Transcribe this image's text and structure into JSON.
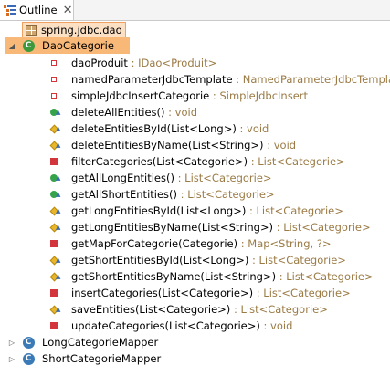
{
  "tab": {
    "title": "Outline",
    "close": "✕"
  },
  "tree": {
    "package": "spring.jdbc.dao",
    "dao_class": "DaoCategorie",
    "members": [
      {
        "name": "daoProduit",
        "type": " : IDao<Produit>",
        "icon": "field-private-icon"
      },
      {
        "name": "namedParameterJdbcTemplate",
        "type": " : NamedParameterJdbcTemplate",
        "icon": "field-private-icon"
      },
      {
        "name": "simpleJdbcInsertCategorie",
        "type": " : SimpleJdbcInsert",
        "icon": "field-private-icon"
      },
      {
        "name": "deleteAllEntities()",
        "type": " : void",
        "icon": "method-public-icon"
      },
      {
        "name": "deleteEntitiesById(List<Long>)",
        "type": " : void",
        "icon": "method-protected-icon"
      },
      {
        "name": "deleteEntitiesByName(List<String>)",
        "type": " : void",
        "icon": "method-protected-icon"
      },
      {
        "name": "filterCategories(List<Categorie>)",
        "type": " : List<Categorie>",
        "icon": "method-private-icon"
      },
      {
        "name": "getAllLongEntities()",
        "type": " : List<Categorie>",
        "icon": "method-public-icon"
      },
      {
        "name": "getAllShortEntities()",
        "type": " : List<Categorie>",
        "icon": "method-public-icon"
      },
      {
        "name": "getLongEntitiesById(List<Long>)",
        "type": " : List<Categorie>",
        "icon": "method-protected-icon"
      },
      {
        "name": "getLongEntitiesByName(List<String>)",
        "type": " : List<Categorie>",
        "icon": "method-protected-icon"
      },
      {
        "name": "getMapForCategorie(Categorie)",
        "type": " : Map<String, ?>",
        "icon": "method-private-icon"
      },
      {
        "name": "getShortEntitiesById(List<Long>)",
        "type": " : List<Categorie>",
        "icon": "method-protected-icon"
      },
      {
        "name": "getShortEntitiesByName(List<String>)",
        "type": " : List<Categorie>",
        "icon": "method-protected-icon"
      },
      {
        "name": "insertCategories(List<Categorie>)",
        "type": " : List<Categorie>",
        "icon": "method-private-icon"
      },
      {
        "name": "saveEntities(List<Categorie>)",
        "type": " : List<Categorie>",
        "icon": "method-protected-icon"
      },
      {
        "name": "updateCategories(List<Categorie>)",
        "type": " : void",
        "icon": "method-private-icon"
      }
    ],
    "other_classes": [
      "LongCategorieMapper",
      "ShortCategorieMapper"
    ]
  },
  "colors": {
    "selection_package": "#fbe0c4",
    "selection_class": "#f8b978",
    "type_text": "#9b7b45"
  }
}
